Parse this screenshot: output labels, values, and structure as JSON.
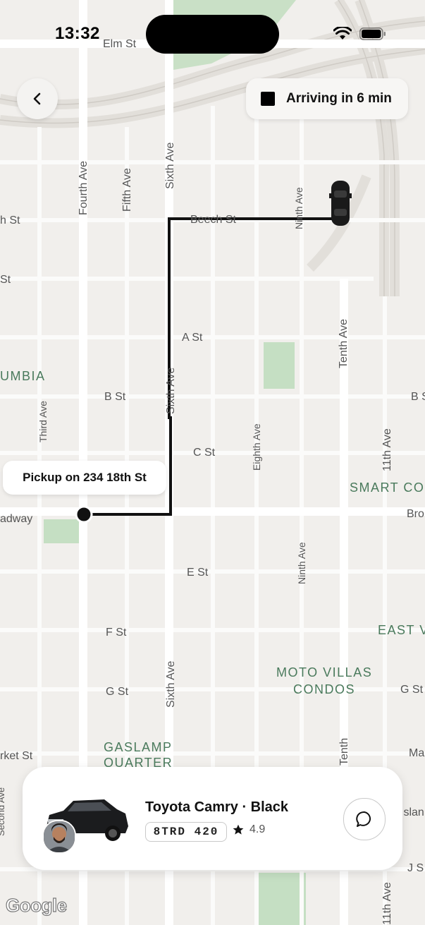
{
  "status": {
    "time": "13:32"
  },
  "header": {
    "arrival_text": "Arriving in 6 min"
  },
  "map": {
    "pickup_label": "Pickup on 234 18th St",
    "streets": {
      "elm": "Elm St",
      "beech": "Beech St",
      "beech_left": "h St",
      "st_left": "St",
      "a": "A St",
      "b": "B St",
      "b_right": "B S",
      "c": "C St",
      "broadway_left": "adway",
      "broadway_right": "Bro",
      "e": "E St",
      "f": "F St",
      "g": "G St",
      "g_right": "G St",
      "market_left": "rket St",
      "market_right": "Ma",
      "j_right": "J S",
      "fourth": "Fourth Ave",
      "fifth": "Fifth Ave",
      "sixth_top": "Sixth Ave",
      "sixth_mid": "Sixth Ave",
      "sixth_bottom": "Sixth Ave",
      "third": "Third Ave",
      "second": "Second Ave",
      "eighth": "Eighth Ave",
      "ninth_top": "Ninth Ave",
      "ninth_bottom": "Ninth Ave",
      "tenth": "Tenth Ave",
      "tenth_bottom": "Tenth",
      "eleventh": "11th Ave",
      "eleventh_bottom": "11th Ave",
      "island": "Islan"
    },
    "districts": {
      "columbia": "UMBIA",
      "smart": "SMART CO",
      "east": "EAST V",
      "moto_1": "MOTO VILLAS",
      "moto_2": "CONDOS",
      "gaslamp_1": "GASLAMP",
      "gaslamp_2": "QUARTER"
    },
    "attribution": "Google"
  },
  "driver_card": {
    "car_name": "Toyota Camry · Black",
    "plate": "8TRD 420",
    "rating": "4.9"
  },
  "icons": {
    "back": "chevron-left-icon",
    "chat": "chat-bubble-icon",
    "star": "star-icon",
    "wifi": "wifi-icon",
    "battery": "battery-icon"
  },
  "colors": {
    "route": "#111111",
    "park": "#c5dfc3",
    "road": "#ffffff",
    "land": "#f1efec",
    "district": "#4a7a5c"
  }
}
